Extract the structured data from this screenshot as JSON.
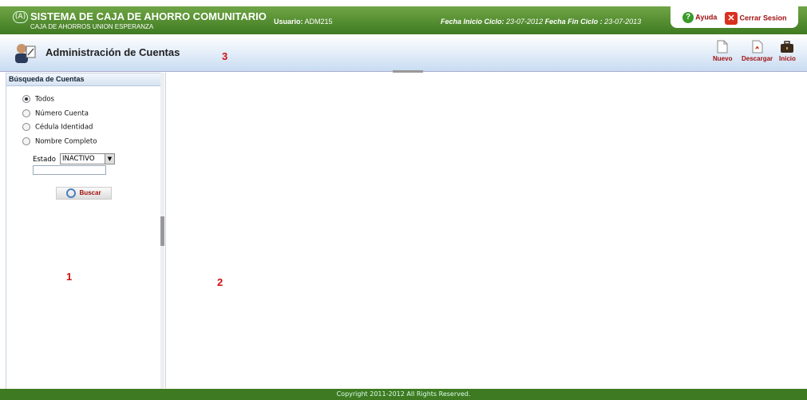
{
  "header": {
    "logo_text": "(A)",
    "title": "SISTEMA DE CAJA DE AHORRO COMUNITARIO",
    "subtitle": "CAJA DE AHORROS UNION ESPERANZA",
    "usuario_label": "Usuario:",
    "usuario_value": "ADM215",
    "fecha_inicio_label": "Fecha Inicio Ciclo:",
    "fecha_inicio_value": "23-07-2012",
    "fecha_fin_label": "Fecha Fin Ciclo :",
    "fecha_fin_value": "23-07-2013",
    "ayuda_label": "Ayuda",
    "cerrar_label": "Cerrar Sesion"
  },
  "titlebar": {
    "title": "Administración de Cuentas",
    "marker": "3",
    "tools": {
      "nuevo": "Nuevo",
      "descargar": "Descargar",
      "inicio": "Inicio"
    }
  },
  "sidebar": {
    "header": "Búsqueda de Cuentas",
    "options": [
      "Todos",
      "Número Cuenta",
      "Cédula Identidad",
      "Nombre Completo"
    ],
    "selected_option": "Todos",
    "estado_label": "Estado",
    "estado_value": "INACTIVO",
    "buscar_label": "Buscar",
    "marker": "1"
  },
  "content": {
    "marker": "2"
  },
  "footer": {
    "text": "Copyright 2011-2012 All Rights Reserved."
  },
  "colors": {
    "header_green": "#3f7a22",
    "accent_red": "#a01010",
    "title_blue": "#c8dcf2"
  }
}
